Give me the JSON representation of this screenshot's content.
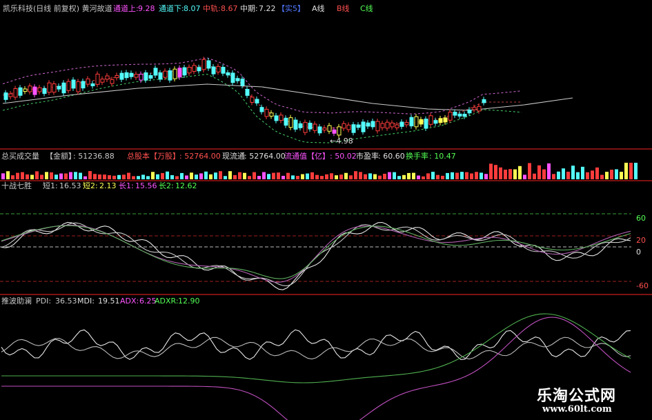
{
  "price_header": {
    "title": "凯乐科技(日线 前复权) 黄河故道",
    "upper_label": "通道上:",
    "upper_value": "9.28",
    "lower_label": "通道下:",
    "lower_value": "8.07",
    "mid_label": "中轨:",
    "mid_value": "8.67",
    "midterm_label": "中期:",
    "midterm_value": "7.22",
    "real5": "【实5】",
    "a_label": "A线",
    "b_label": "B线",
    "c_label": "C线"
  },
  "price_annotation": "←4.98",
  "volume_header": {
    "title": "总买成交量",
    "amount_label": "【金额】",
    "amount_value": ": 51236.88",
    "total_shares_label": "总股本【万股】",
    "total_shares_value": ": 52764.00",
    "float_label": "现流通",
    "float_value": ": 52764.00",
    "float_mv_label": "流通值【亿】",
    "float_mv_value": ": 50.02",
    "pe_label": "市盈率",
    "pe_value": ": 60.60",
    "turnover_label": "换手率",
    "turnover_value": ": 10.47"
  },
  "indicator1_header": {
    "title": "十战七胜",
    "s1_label": "短1:",
    "s1_value": "16.53",
    "s2_label": "短2:",
    "s2_value": "2.13",
    "l1_label": "长1:",
    "l1_value": "15.56",
    "l2_label": "长2:",
    "l2_value": "12.62"
  },
  "indicator1_axis": [
    "60",
    "20",
    "0",
    "-60"
  ],
  "indicator2_header": {
    "title": "推波助澜",
    "pdi_label": "PDI:",
    "pdi_value": "36.53",
    "mdi_label": "MDI:",
    "mdi_value": "19.51",
    "adx_label": "ADX:",
    "adx_value": "6.25",
    "adxr_label": "ADXR:",
    "adxr_value": "12.90"
  },
  "watermark": {
    "title": "乐淘公式网",
    "url": "www.60lt.com"
  },
  "colors": {
    "background": "#000000",
    "up": "#ff3c3c",
    "down": "#54fcfc",
    "yellow": "#ffff54",
    "magenta": "#ff54ff",
    "green": "#54ff54",
    "divider": "#c81e1e"
  }
}
